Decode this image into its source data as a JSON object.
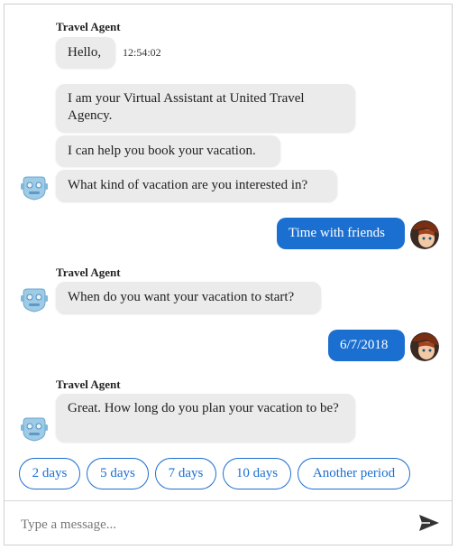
{
  "conversation": {
    "agent_name": "Travel Agent",
    "messages": [
      {
        "text": "Hello,",
        "time": "12:54:02"
      },
      {
        "text": "I am your Virtual Assistant at United Travel Agency."
      },
      {
        "text": "I can help you book your vacation."
      },
      {
        "text": "What kind of vacation are you interested in?"
      },
      {
        "text": "Time with friends"
      },
      {
        "text": "When do you want your vacation to start?"
      },
      {
        "text": "6/7/2018"
      },
      {
        "text": "Great. How long do you plan your vacation to be?"
      }
    ]
  },
  "suggested_actions": [
    "2 days",
    "5 days",
    "7 days",
    "10 days",
    "Another period"
  ],
  "composer": {
    "placeholder": "Type a message..."
  },
  "colors": {
    "accent": "#1b6fd1",
    "bubble": "#ebebeb"
  },
  "icons": {
    "bot_avatar": "robot-icon",
    "user_avatar": "user-avatar",
    "send": "send-icon"
  }
}
